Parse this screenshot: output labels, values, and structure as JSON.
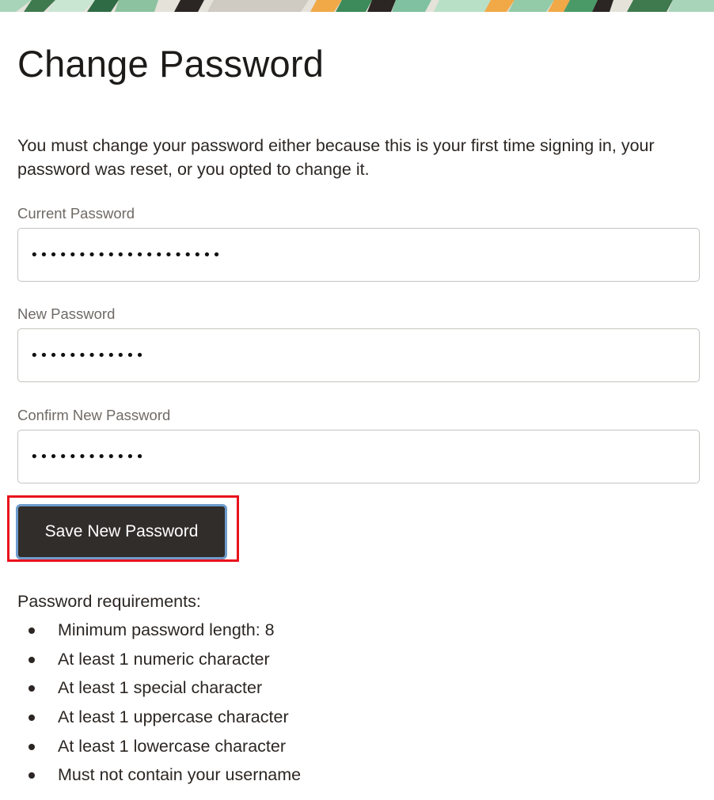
{
  "page": {
    "title": "Change Password",
    "intro": "You must change your password either because this is your first time signing in, your password was reset, or you opted to change it."
  },
  "form": {
    "current_password": {
      "label": "Current Password",
      "value": "••••••••••••••••••••"
    },
    "new_password": {
      "label": "New Password",
      "value": "••••••••••••"
    },
    "confirm_password": {
      "label": "Confirm New Password",
      "value": "••••••••••••"
    },
    "save_button_label": "Save New Password"
  },
  "requirements": {
    "heading": "Password requirements:",
    "items": [
      "Minimum password length: 8",
      "At least 1 numeric character",
      "At least 1 special character",
      "At least 1 uppercase character",
      "At least 1 lowercase character",
      "Must not contain your username"
    ]
  },
  "colors": {
    "button_background": "#312d2a",
    "button_focus_ring": "#6f9ccc",
    "highlight_annotation": "#e8121c"
  }
}
